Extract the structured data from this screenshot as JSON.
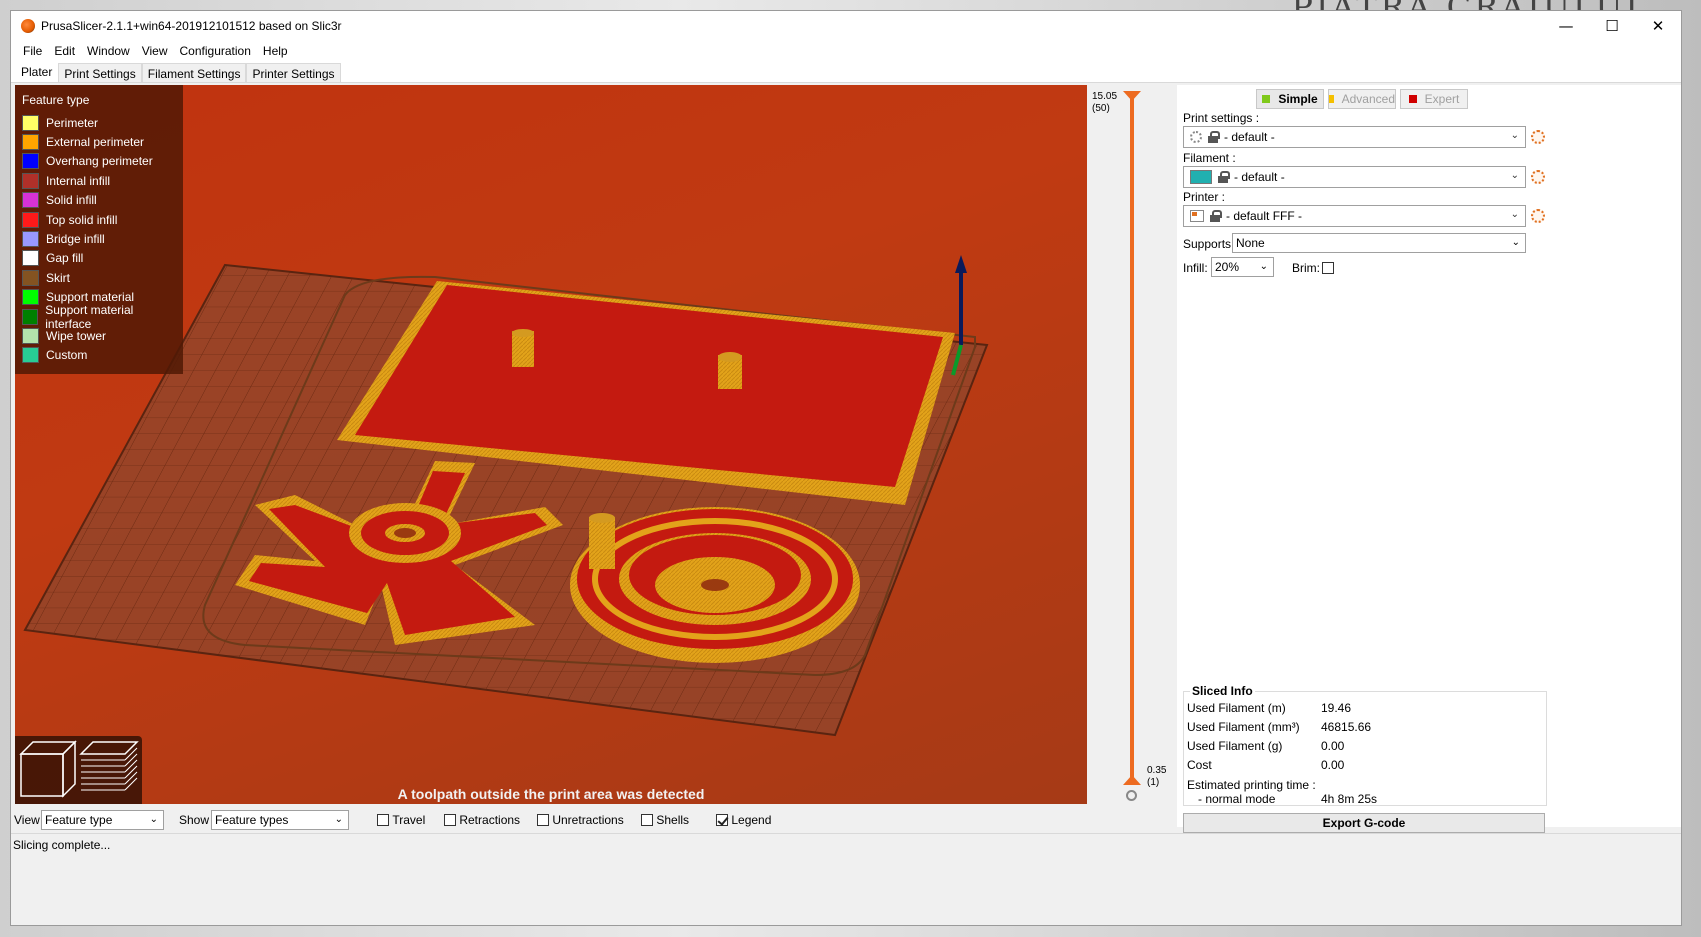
{
  "window": {
    "title": "PrusaSlicer-2.1.1+win64-201912101512 based on Slic3r",
    "controls": {
      "minimize": "—",
      "maximize": "☐",
      "close": "✕"
    }
  },
  "desktop": {
    "text": "PIATRA CRAIULUI"
  },
  "menu": [
    "File",
    "Edit",
    "Window",
    "View",
    "Configuration",
    "Help"
  ],
  "tabs": [
    {
      "label": "Plater",
      "active": true
    },
    {
      "label": "Print Settings",
      "active": false
    },
    {
      "label": "Filament Settings",
      "active": false
    },
    {
      "label": "Printer Settings",
      "active": false
    }
  ],
  "legend": {
    "title": "Feature type",
    "items": [
      {
        "label": "Perimeter",
        "color": "#ffff66"
      },
      {
        "label": "External perimeter",
        "color": "#ffa500"
      },
      {
        "label": "Overhang perimeter",
        "color": "#0000ff"
      },
      {
        "label": "Internal infill",
        "color": "#b03029"
      },
      {
        "label": "Solid infill",
        "color": "#d732d7"
      },
      {
        "label": "Top solid infill",
        "color": "#ff1a1a"
      },
      {
        "label": "Bridge infill",
        "color": "#9999ff"
      },
      {
        "label": "Gap fill",
        "color": "#ffffff"
      },
      {
        "label": "Skirt",
        "color": "#845321"
      },
      {
        "label": "Support material",
        "color": "#00ff00"
      },
      {
        "label": "Support material interface",
        "color": "#008000"
      },
      {
        "label": "Wipe tower",
        "color": "#b3e3ab"
      },
      {
        "label": "Custom",
        "color": "#28cc94"
      }
    ]
  },
  "viewport": {
    "warning": "A toolpath outside the print area was detected"
  },
  "layer_slider": {
    "top_value": "15.05",
    "top_layer": "(50)",
    "bottom_value": "0.35",
    "bottom_layer": "(1)"
  },
  "sidebar": {
    "modes": [
      {
        "label": "Simple",
        "color": "#7fc91a",
        "active": true
      },
      {
        "label": "Advanced",
        "color": "#f5c000",
        "active": false
      },
      {
        "label": "Expert",
        "color": "#d00000",
        "active": false
      }
    ],
    "print_settings": {
      "label": "Print settings :",
      "value": "- default -"
    },
    "filament": {
      "label": "Filament :",
      "value": "- default -",
      "color": "#21b0b0"
    },
    "printer": {
      "label": "Printer :",
      "value": "- default FFF -"
    },
    "supports": {
      "label": "Supports:",
      "value": "None"
    },
    "infill": {
      "label": "Infill:",
      "value": "20%"
    },
    "brim": {
      "label": "Brim:",
      "checked": false
    },
    "sliced_info": {
      "title": "Sliced Info",
      "rows": [
        {
          "label": "Used Filament (m)",
          "value": "19.46"
        },
        {
          "label": "Used Filament (mm³)",
          "value": "46815.66"
        },
        {
          "label": "Used Filament (g)",
          "value": "0.00"
        },
        {
          "label": "Cost",
          "value": "0.00"
        },
        {
          "label": "Estimated printing time :",
          "value": ""
        },
        {
          "label": "- normal mode",
          "value": "4h 8m 25s"
        }
      ]
    },
    "export_label": "Export G-code"
  },
  "bottom_bar": {
    "view_label": "View",
    "view_value": "Feature type",
    "show_label": "Show",
    "show_value": "Feature types",
    "checkboxes": [
      {
        "label": "Travel",
        "checked": false
      },
      {
        "label": "Retractions",
        "checked": false
      },
      {
        "label": "Unretractions",
        "checked": false
      },
      {
        "label": "Shells",
        "checked": false
      },
      {
        "label": "Legend",
        "checked": true
      }
    ]
  },
  "status": "Slicing complete..."
}
